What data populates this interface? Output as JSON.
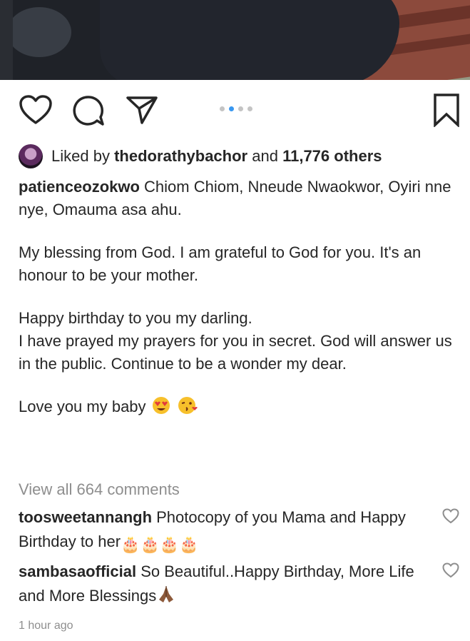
{
  "post": {
    "liked_by_prefix": "Liked by",
    "liked_by_user": "thedorathybachor",
    "liked_by_and": "and",
    "liked_by_others": "11,776 others",
    "author": "patienceozokwo",
    "caption_line1": " Chiom  Chiom, Nneude Nwaokwor, Oyiri nne nye, Omauma asa ahu.",
    "caption_p2": "My blessing from God. I am grateful to God for you. It's an honour to be your mother.",
    "caption_p3a": "Happy birthday to you my darling.",
    "caption_p3b": "I have prayed my prayers for you in secret. God will answer us in the public. Continue to be a wonder my dear.",
    "caption_p4": "Love you my baby",
    "view_all_comments": "View all 664 comments",
    "comments": [
      {
        "user": "toosweetannangh",
        "text": " Photocopy of you Mama and Happy Birthday to her"
      },
      {
        "user": "sambasaofficial",
        "text": " So Beautiful..Happy Birthday, More Life and More Blessings"
      }
    ],
    "timestamp": "1 hour ago"
  },
  "icons": {
    "like": "heart-icon",
    "comment": "comment-icon",
    "share": "send-icon",
    "save": "bookmark-icon"
  },
  "carousel": {
    "count": 4,
    "active_index": 1
  },
  "colors": {
    "accent": "#3897f0",
    "muted": "#8e8e8e",
    "text": "#262626"
  }
}
